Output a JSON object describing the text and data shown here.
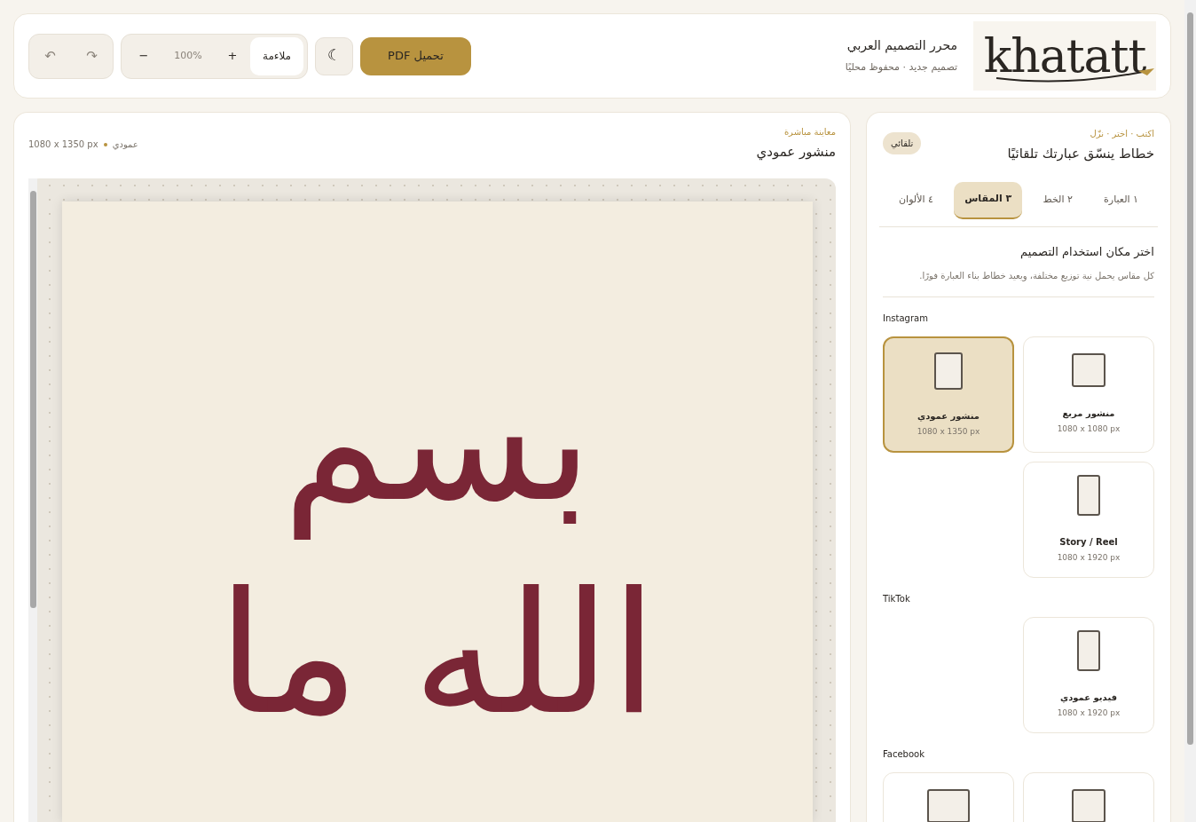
{
  "header": {
    "logo_text": "khatatt",
    "title": "محرر التصميم العربي",
    "subtitle": "تصميم جديد · محفوظ محليًا",
    "download_button": "تحميل PDF",
    "theme_icon": "☾",
    "fit_button": "ملاءمة",
    "zoom_in": "+",
    "zoom_level": "100%",
    "zoom_out": "−",
    "redo": "↷",
    "undo": "↶"
  },
  "sidebar": {
    "eyebrow": "اكتب · اختر · نزّل",
    "title": "خطاط ينسّق عبارتك تلقائيًا",
    "badge": "تلقائي",
    "steps": [
      {
        "label": "١ العبارة",
        "selected": false
      },
      {
        "label": "٢ الخط",
        "selected": false
      },
      {
        "label": "٣ المقاس",
        "selected": true
      },
      {
        "label": "٤ الألوان",
        "selected": false
      }
    ],
    "section_title": "اختر مكان استخدام التصميم",
    "section_text": "كل مقاس يحمل نية توزيع مختلفة، ويعيد خطاط بناء العبارة فورًا.",
    "groups": [
      {
        "name": "Instagram",
        "formats": [
          {
            "kind": "square",
            "label": "منشور مربع",
            "size": "1080 x 1080 px",
            "selected": false
          },
          {
            "kind": "portrait",
            "label": "منشور عمودي",
            "size": "1080 x 1350 px",
            "selected": true
          },
          {
            "kind": "tall",
            "label": "Story / Reel",
            "size": "1080 x 1920 px",
            "selected": false
          }
        ]
      },
      {
        "name": "TikTok",
        "formats": [
          {
            "kind": "tall",
            "label": "فيديو عمودي",
            "size": "1080 x 1920 px",
            "selected": false
          }
        ]
      },
      {
        "name": "Facebook",
        "formats": [
          {
            "kind": "square",
            "selected": false
          },
          {
            "kind": "landscape",
            "selected": false
          }
        ]
      }
    ]
  },
  "preview": {
    "eyebrow": "معاينة مباشرة",
    "title": "منشور عمودي",
    "orientation": "عمودي",
    "size": "1080 x 1350 px",
    "lines": [
      "بسم",
      "الله ما"
    ]
  }
}
